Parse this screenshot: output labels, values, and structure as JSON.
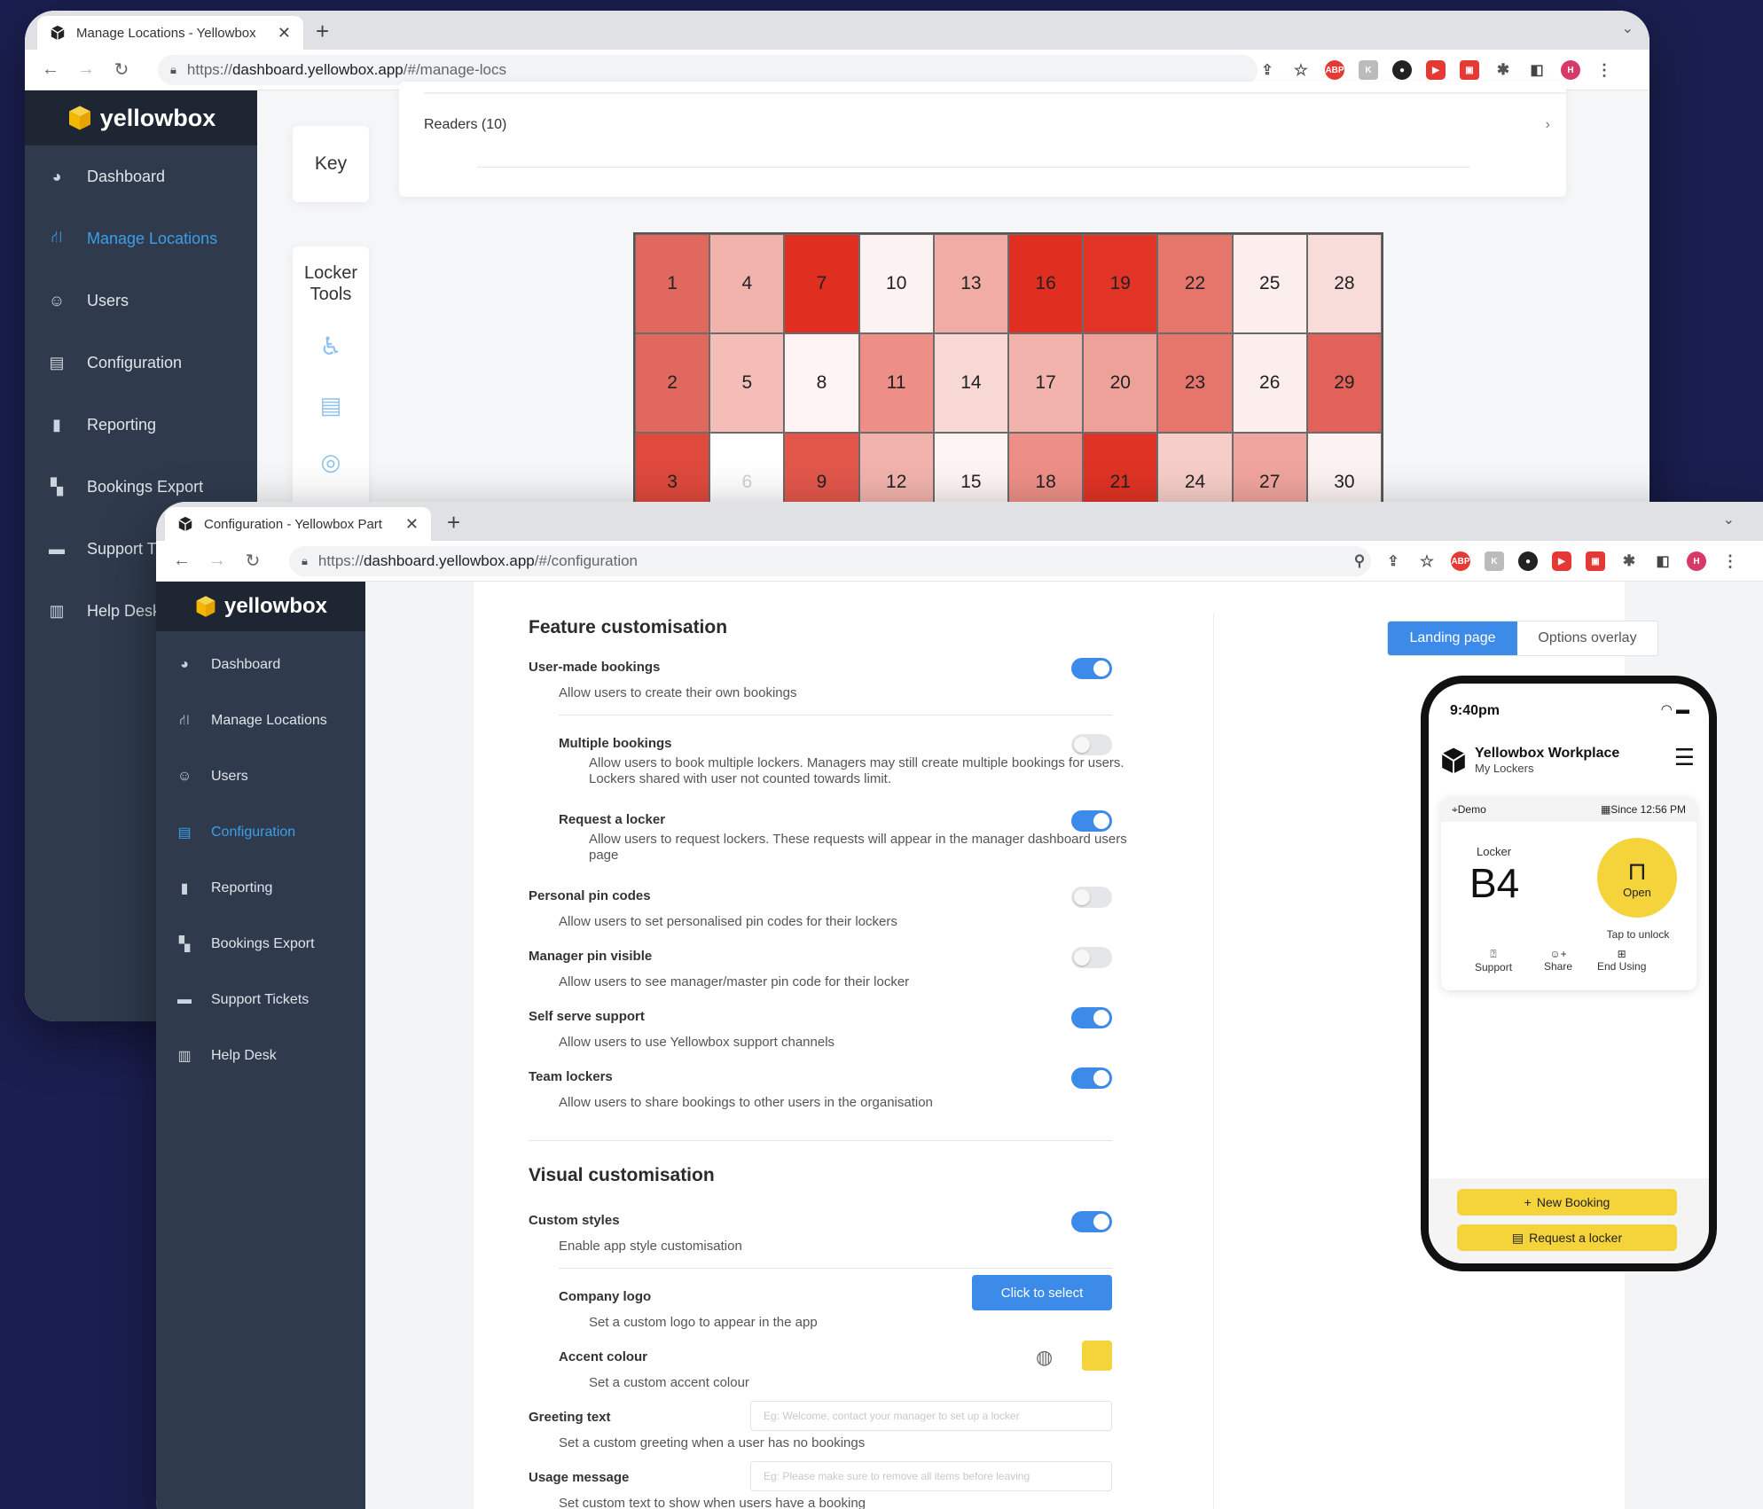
{
  "colors": {
    "accent": "#3d8be8",
    "sidebar": "#2f3b4d",
    "brand_yellow": "#f5c518",
    "background": "#1b1f50"
  },
  "window1": {
    "tab_title": "Manage Locations - Yellowbox",
    "url_prefix": "https://",
    "url_host": "dashboard.yellowbox.app",
    "url_path": "/#/manage-locs",
    "brand": "yellowbox",
    "sidebar": [
      {
        "label": "Dashboard",
        "icon": "dashboard-icon"
      },
      {
        "label": "Manage Locations",
        "icon": "sitemap-icon"
      },
      {
        "label": "Users",
        "icon": "user-icon"
      },
      {
        "label": "Configuration",
        "icon": "config-icon"
      },
      {
        "label": "Reporting",
        "icon": "bar-chart-icon"
      },
      {
        "label": "Bookings Export",
        "icon": "export-icon"
      },
      {
        "label": "Support Ti",
        "icon": "chat-icon"
      },
      {
        "label": "Help Desk",
        "icon": "book-icon"
      }
    ],
    "key_label": "Key",
    "readers_label": "Readers (10)",
    "locker_tools_label": "Locker Tools",
    "lockers": [
      {
        "n": "1",
        "c": "#e0685e"
      },
      {
        "n": "4",
        "c": "#f2b3ad"
      },
      {
        "n": "7",
        "c": "#e02f21"
      },
      {
        "n": "10",
        "c": "#fcf2f1"
      },
      {
        "n": "13",
        "c": "#f1aca6"
      },
      {
        "n": "16",
        "c": "#e02f21"
      },
      {
        "n": "19",
        "c": "#e13426"
      },
      {
        "n": "22",
        "c": "#e6756c"
      },
      {
        "n": "25",
        "c": "#fbeeed"
      },
      {
        "n": "28",
        "c": "#f8dcd9"
      },
      {
        "n": "2",
        "c": "#e0685e"
      },
      {
        "n": "5",
        "c": "#f4bdb7"
      },
      {
        "n": "8",
        "c": "#fdf4f3"
      },
      {
        "n": "11",
        "c": "#ed8f87"
      },
      {
        "n": "14",
        "c": "#f8d8d5"
      },
      {
        "n": "17",
        "c": "#f2b3ad"
      },
      {
        "n": "20",
        "c": "#eea199"
      },
      {
        "n": "23",
        "c": "#e6756c"
      },
      {
        "n": "26",
        "c": "#fbeeed"
      },
      {
        "n": "29",
        "c": "#e2625a"
      },
      {
        "n": "3",
        "c": "#df4a3d"
      },
      {
        "n": "6",
        "c": "#ffffff",
        "muted": true
      },
      {
        "n": "9",
        "c": "#e3574b"
      },
      {
        "n": "12",
        "c": "#f2b3ad"
      },
      {
        "n": "15",
        "c": "#fdf4f3"
      },
      {
        "n": "18",
        "c": "#ed8f87"
      },
      {
        "n": "21",
        "c": "#df3325"
      },
      {
        "n": "24",
        "c": "#f6cdc8"
      },
      {
        "n": "27",
        "c": "#f0a59e"
      },
      {
        "n": "30",
        "c": "#fcf2f1"
      }
    ]
  },
  "window2": {
    "tab_title": "Configuration - Yellowbox Part",
    "url_prefix": "https://",
    "url_host": "dashboard.yellowbox.app",
    "url_path": "/#/configuration",
    "brand": "yellowbox",
    "sidebar": [
      {
        "label": "Dashboard",
        "icon": "dashboard-icon"
      },
      {
        "label": "Manage Locations",
        "icon": "sitemap-icon"
      },
      {
        "label": "Users",
        "icon": "user-icon"
      },
      {
        "label": "Configuration",
        "icon": "config-icon"
      },
      {
        "label": "Reporting",
        "icon": "bar-chart-icon"
      },
      {
        "label": "Bookings Export",
        "icon": "export-icon"
      },
      {
        "label": "Support Tickets",
        "icon": "chat-icon"
      },
      {
        "label": "Help Desk",
        "icon": "book-icon"
      }
    ],
    "feature_title": "Feature customisation",
    "features": [
      {
        "label": "User-made bookings",
        "desc": "Allow users to create their own bookings",
        "on": true
      },
      {
        "label": "Multiple bookings",
        "desc": "Allow users to book multiple lockers. Managers may still create multiple bookings for users. Lockers shared with user not counted towards limit.",
        "on": false
      },
      {
        "label": "Request a locker",
        "desc": "Allow users to request lockers. These requests will appear in the manager dashboard users page",
        "on": true
      },
      {
        "label": "Personal pin codes",
        "desc": "Allow users to set personalised pin codes for their lockers",
        "on": false
      },
      {
        "label": "Manager pin visible",
        "desc": "Allow users to see manager/master pin code for their locker",
        "on": false
      },
      {
        "label": "Self serve support",
        "desc": "Allow users to use Yellowbox support channels",
        "on": true
      },
      {
        "label": "Team lockers",
        "desc": "Allow users to share bookings to other users in the organisation",
        "on": true
      }
    ],
    "visual_title": "Visual customisation",
    "custom_styles": {
      "label": "Custom styles",
      "desc": "Enable app style customisation",
      "on": true
    },
    "company_logo": {
      "label": "Company logo",
      "desc": "Set a custom logo to appear in the app",
      "button": "Click to select"
    },
    "accent_colour": {
      "label": "Accent colour",
      "desc": "Set a custom accent colour",
      "value": "#f5d33a"
    },
    "greeting": {
      "label": "Greeting text",
      "desc": "Set a custom greeting when a user has no bookings",
      "placeholder": "Eg: Welcome, contact your manager to set up a locker"
    },
    "usage": {
      "label": "Usage message",
      "desc": "Set custom text to show when users have a booking",
      "placeholder": "Eg: Please make sure to remove all items before leaving"
    },
    "preview_tabs": [
      "Landing page",
      "Options overlay"
    ],
    "phone": {
      "time": "9:40pm",
      "org": "Yellowbox Workplace",
      "sub": "My Lockers",
      "location": "Demo",
      "since": "Since 12:56 PM",
      "locker_label": "Locker",
      "locker_id": "B4",
      "open": "Open",
      "tap": "Tap to unlock",
      "actions": [
        "Support",
        "Share",
        "End Using"
      ],
      "new_booking": "New Booking",
      "request": "Request a locker"
    }
  }
}
